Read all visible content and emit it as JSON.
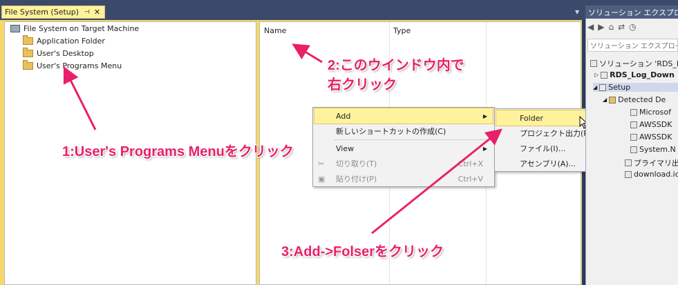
{
  "tab": {
    "title": "File System (Setup)",
    "pin": "⊣",
    "close": "✕"
  },
  "left_tree": {
    "root": "File System on Target Machine",
    "items": [
      "Application Folder",
      "User's Desktop",
      "User's Programs Menu"
    ]
  },
  "columns": {
    "name": "Name",
    "type": "Type"
  },
  "context_menu": {
    "items": [
      {
        "label": "Add",
        "shortcut": "",
        "submenu": true,
        "disabled": false
      },
      {
        "label": "新しいショートカットの作成(C)",
        "shortcut": "",
        "submenu": false,
        "disabled": false
      },
      {
        "label": "View",
        "shortcut": "",
        "submenu": true,
        "disabled": false
      },
      {
        "label": "切り取り(T)",
        "shortcut": "Ctrl+X",
        "submenu": false,
        "disabled": true
      },
      {
        "label": "貼り付け(P)",
        "shortcut": "Ctrl+V",
        "submenu": false,
        "disabled": true
      }
    ]
  },
  "submenu": {
    "items": [
      "Folder",
      "プロジェクト出力(P)...",
      "ファイル(I)...",
      "アセンブリ(A)..."
    ]
  },
  "solution_explorer": {
    "title": "ソリューション エクスプローラー",
    "search_placeholder": "ソリューション エクスプローラー",
    "items": [
      "ソリューション 'RDS_L",
      "RDS_Log_Down",
      "Setup",
      "Detected De",
      "Microsof",
      "AWSSDK",
      "AWSSDK",
      "System.N",
      "プライマリ出力",
      "download.ic"
    ]
  },
  "annotations": {
    "step1": "1:User's Programs Menuをクリック",
    "step2_line1": "2:このウインドウ内で",
    "step2_line2": "右クリック",
    "step3": "3:Add->Folserをクリック"
  },
  "colors": {
    "accent": "#e8206a",
    "tab_bg": "#fff29d",
    "chrome": "#3b4a6b"
  }
}
